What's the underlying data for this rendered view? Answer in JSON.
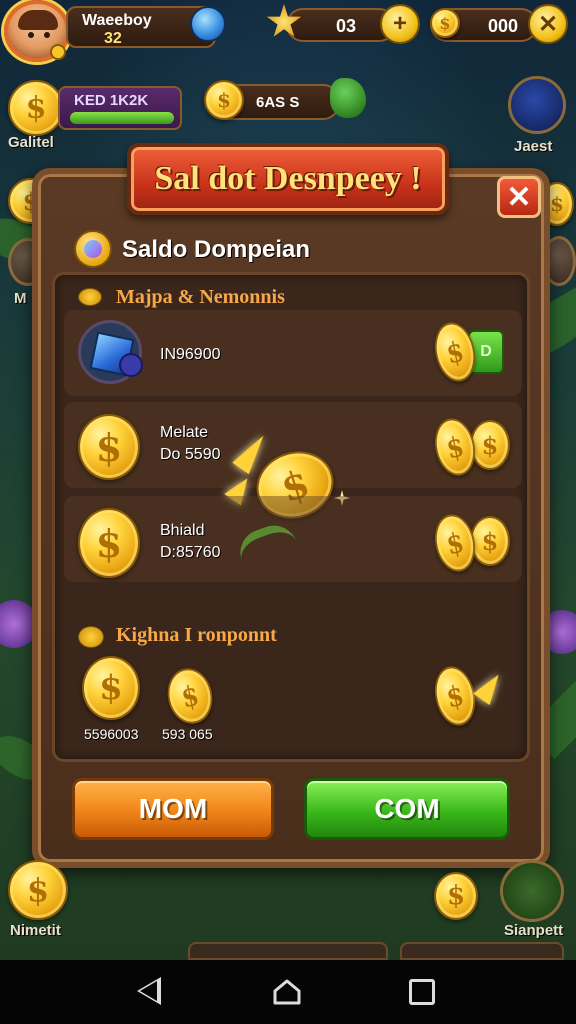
{
  "hud": {
    "player_name": "Waeeboy",
    "player_level": "32",
    "currency_1": "03",
    "currency_2": "000",
    "bar_left_text": "KED 1K2K",
    "bar_mid_text": "6AS S",
    "left_label": "Galitel",
    "right_label": "Jaest",
    "side_left_label": "M",
    "bottom_left_label": "Nimetit",
    "bottom_right_label": "Sianpett",
    "plus_symbol": "+",
    "close_symbol": "✕"
  },
  "modal": {
    "title": "Sal dot Desnpeey !",
    "subheader": "Saldo Dompeian",
    "section_1_label": "Majpa & Nemonnis",
    "section_2_label": "Kighna I ronponnt",
    "rows": [
      {
        "line1": "IN96900",
        "line2": ""
      },
      {
        "line1": "Melate",
        "line2": "Do 5590"
      },
      {
        "line1": "Bhiald",
        "line2": "D:85760"
      }
    ],
    "bottom_values": [
      "5596003",
      "593 065"
    ],
    "mini_button_text": "D",
    "button_left": "MOM",
    "button_right": "COM",
    "coin_symbol": "$"
  },
  "colors": {
    "accent_orange": "#f08418",
    "accent_green": "#3ab81a",
    "title_red": "#c8321a",
    "gold": "#ffd23a"
  },
  "icons": [
    "player-avatar-icon",
    "gem-icon",
    "star-badge-icon",
    "coin-icon",
    "close-icon",
    "cube-gem-icon",
    "sparkle-icon",
    "arrow-icon",
    "nav-back-icon",
    "nav-home-icon",
    "nav-recent-icon"
  ]
}
